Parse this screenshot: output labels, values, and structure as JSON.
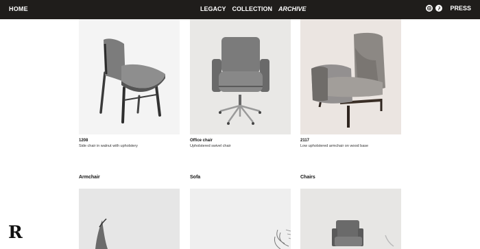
{
  "nav": {
    "home": "HOME",
    "links": [
      "LEGACY",
      "COLLECTION",
      "ARCHIVE"
    ],
    "active": "ARCHIVE",
    "social_icons": [
      "instagram-icon",
      "pinterest-icon"
    ],
    "press": "PRESS"
  },
  "products": [
    {
      "code": "1208",
      "description": "Side chair in walnut with upholstery"
    },
    {
      "code": "Office chair",
      "description": "Upholstered swivel chair"
    },
    {
      "code": "2117",
      "description": "Low upholstered armchair on wood base"
    }
  ],
  "sections": [
    "Armchair",
    "Sofa",
    "Chairs"
  ],
  "logo": "R"
}
